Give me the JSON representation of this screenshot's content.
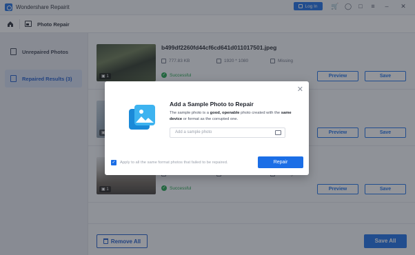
{
  "app": {
    "title": "Wondershare Repairit",
    "login_label": "Log In"
  },
  "nav": {
    "title": "Photo Repair"
  },
  "sidebar": {
    "items": [
      {
        "label": "Unrepaired Photos"
      },
      {
        "label": "Repaired Results (3)"
      }
    ]
  },
  "rows": [
    {
      "filename": "b499df2260fd44cf6cd641d011017501.jpeg",
      "size": "777.83 KB",
      "resolution": "1920 * 1080",
      "camera": "Missing",
      "status": "Successful",
      "badge": "1",
      "preview": "Preview",
      "save": "Save"
    },
    {
      "filename": "",
      "size": "",
      "resolution": "",
      "camera": "",
      "status": "",
      "badge": "1",
      "preview": "Preview",
      "save": "Save"
    },
    {
      "filename": "",
      "size": "106.74 KB",
      "resolution": "910 * 601",
      "camera": "Missing",
      "status": "Successful",
      "badge": "1",
      "preview": "Preview",
      "save": "Save"
    }
  ],
  "bottom": {
    "remove_all": "Remove All",
    "save_all": "Save All"
  },
  "modal": {
    "title": "Add a Sample Photo to Repair",
    "desc_1": "The sample photo is a ",
    "desc_good": "good, openable",
    "desc_2": " photo created with the ",
    "desc_same": "same device",
    "desc_3": " or format as the corrupted one.",
    "input_placeholder": "Add a sample photo",
    "apply_label": "Apply to all the same format photos that failed to be repaired.",
    "repair_label": "Repair"
  },
  "colors": {
    "accent": "#1b6ee6",
    "success": "#1fa34a"
  }
}
